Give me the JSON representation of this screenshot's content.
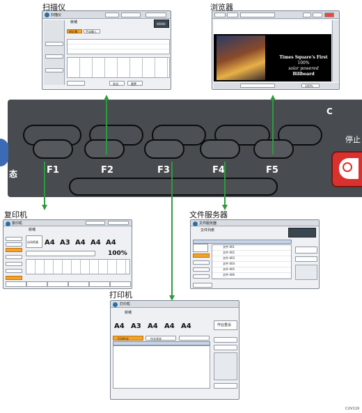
{
  "labels": {
    "scanner": "扫描仪",
    "browser": "浏览器",
    "copier": "复印机",
    "docserver": "文件服务器",
    "printer": "打印机",
    "code": "CUV119"
  },
  "panel": {
    "keys": [
      "F1",
      "F2",
      "F3",
      "F4",
      "F5"
    ],
    "right_text": "停止",
    "c_key": "C",
    "left_glyph": "态"
  },
  "scanner_screen": {
    "title": "扫描仪",
    "subtitle": "就绪",
    "tabs": [
      "地址簿",
      "手动输入"
    ],
    "buttons": [
      "发送",
      "重置"
    ],
    "counter": "00000"
  },
  "browser_screen": {
    "title": "Times Square's First",
    "line2": "100%",
    "line3": "solar powered",
    "line4": "Billboard",
    "zoom": "100%"
  },
  "copier_screen": {
    "title": "复印机",
    "status": "就绪",
    "papers": [
      "A4",
      "A3",
      "A4",
      "A4",
      "A4"
    ],
    "zoom": "100%",
    "tray": "自动纸盒"
  },
  "docserver_screen": {
    "title": "文件服务器",
    "header": "文件列表",
    "rows": [
      "文件-001",
      "文件-002",
      "文件-003",
      "文件-004",
      "文件-005",
      "文件-006"
    ]
  },
  "printer_screen": {
    "title": "打印机",
    "status": "就绪",
    "papers": [
      "A4",
      "A3",
      "A4",
      "A4",
      "A4"
    ],
    "job_button": "作业重设",
    "tabs": [
      "打印作业",
      "作业状态"
    ]
  },
  "colors": {
    "arrow": "#2e9a3e",
    "panel": "#484b4f",
    "accent": "#f6a223"
  }
}
